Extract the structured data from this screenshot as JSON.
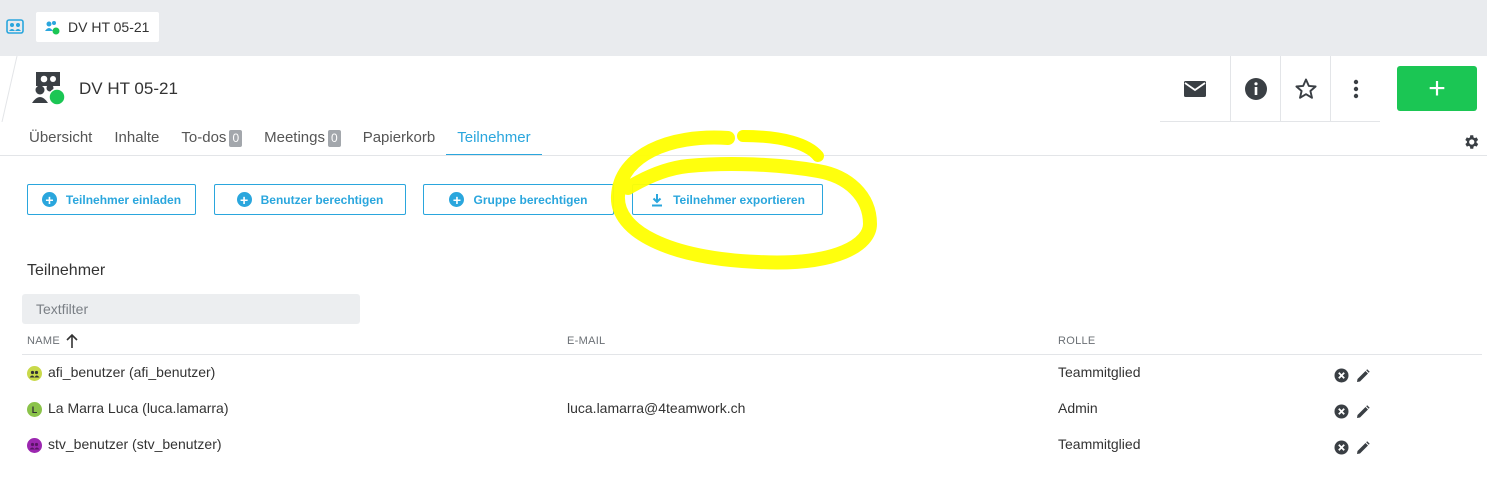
{
  "breadcrumb": {
    "workspace": "DV HT 05-21"
  },
  "header": {
    "title": "DV HT 05-21",
    "add_label": "+"
  },
  "tabs": [
    {
      "label": "Übersicht"
    },
    {
      "label": "Inhalte"
    },
    {
      "label": "To-dos",
      "count": "0"
    },
    {
      "label": "Meetings",
      "count": "0"
    },
    {
      "label": "Papierkorb"
    },
    {
      "label": "Teilnehmer",
      "active": true
    }
  ],
  "buttons": {
    "invite": "Teilnehmer einladen",
    "user_permission": "Benutzer berechtigen",
    "group_permission": "Gruppe berechtigen",
    "export": "Teilnehmer exportieren"
  },
  "participants": {
    "title": "Teilnehmer",
    "filter_placeholder": "Textfilter",
    "columns": {
      "name": "NAME",
      "email": "E-MAIL",
      "role": "ROLLE"
    },
    "rows": [
      {
        "name": "afi_benutzer (afi_benutzer)",
        "email": "",
        "role": "Teammitglied",
        "avatar_color": "#c9d94a",
        "avatar_letter": ""
      },
      {
        "name": "La Marra Luca (luca.lamarra)",
        "email": "luca.lamarra@4teamwork.ch",
        "role": "Admin",
        "avatar_color": "#8bc34a",
        "avatar_letter": "L"
      },
      {
        "name": "stv_benutzer (stv_benutzer)",
        "email": "",
        "role": "Teammitglied",
        "avatar_color": "#9c27b0",
        "avatar_letter": ""
      }
    ]
  },
  "colors": {
    "accent": "#2aa6dd",
    "add": "#1bc654",
    "highlight": "#ffff00"
  }
}
